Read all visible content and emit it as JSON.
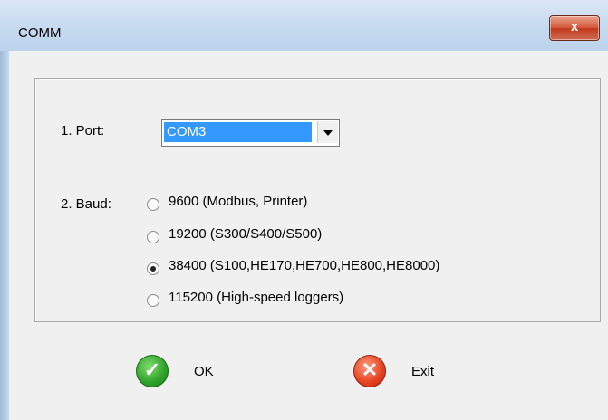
{
  "window": {
    "title": "COMM",
    "close_glyph": "x"
  },
  "form": {
    "port_label": "1. Port:",
    "port_value": "COM3",
    "baud_label": "2. Baud:",
    "baud_options": [
      {
        "label": "9600 (Modbus, Printer)",
        "checked": false
      },
      {
        "label": "19200 (S300/S400/S500)",
        "checked": false
      },
      {
        "label": "38400 (S100,HE170,HE700,HE800,HE8000)",
        "checked": true
      },
      {
        "label": "115200 (High-speed loggers)",
        "checked": false
      }
    ]
  },
  "buttons": {
    "ok": {
      "label": "OK",
      "icon": "checkmark-icon",
      "glyph": "✓",
      "color": "#2ea12a"
    },
    "exit": {
      "label": "Exit",
      "icon": "x-icon",
      "glyph": "✕",
      "color": "#e5401f"
    }
  }
}
